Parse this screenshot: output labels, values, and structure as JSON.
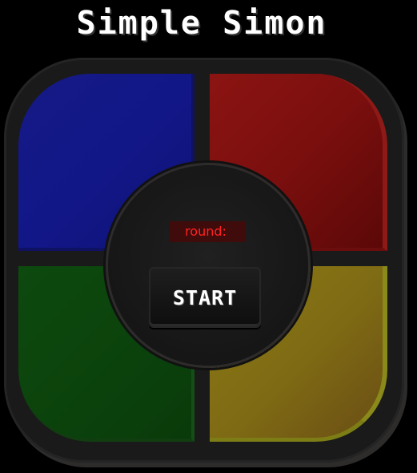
{
  "title": "Simple Simon",
  "board": {
    "pads": [
      {
        "id": "blue",
        "color": "#121788"
      },
      {
        "id": "red",
        "color": "#7a0f0e"
      },
      {
        "id": "green",
        "color": "#0b420c"
      },
      {
        "id": "yellow",
        "color": "#7e6a14"
      }
    ],
    "round_label": "round:",
    "round_value": "",
    "start_label": "START"
  },
  "colors": {
    "background": "#000000",
    "round_text": "#ff2020",
    "round_bg": "#3f0b0b"
  }
}
